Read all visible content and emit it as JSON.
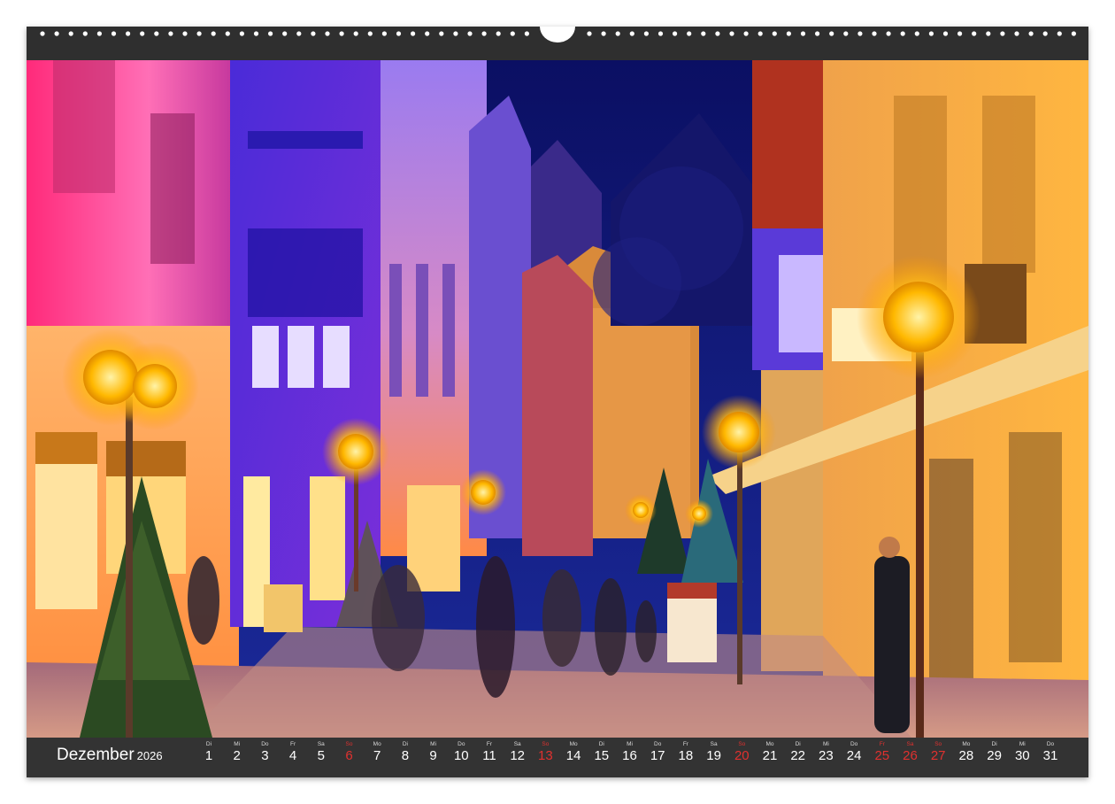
{
  "calendar": {
    "month": "Dezember",
    "year": "2026",
    "days": [
      {
        "wd": "Di",
        "num": "1",
        "red": false
      },
      {
        "wd": "Mi",
        "num": "2",
        "red": false
      },
      {
        "wd": "Do",
        "num": "3",
        "red": false
      },
      {
        "wd": "Fr",
        "num": "4",
        "red": false
      },
      {
        "wd": "Sa",
        "num": "5",
        "red": false
      },
      {
        "wd": "So",
        "num": "6",
        "red": true
      },
      {
        "wd": "Mo",
        "num": "7",
        "red": false
      },
      {
        "wd": "Di",
        "num": "8",
        "red": false
      },
      {
        "wd": "Mi",
        "num": "9",
        "red": false
      },
      {
        "wd": "Do",
        "num": "10",
        "red": false
      },
      {
        "wd": "Fr",
        "num": "11",
        "red": false
      },
      {
        "wd": "Sa",
        "num": "12",
        "red": false
      },
      {
        "wd": "So",
        "num": "13",
        "red": true
      },
      {
        "wd": "Mo",
        "num": "14",
        "red": false
      },
      {
        "wd": "Di",
        "num": "15",
        "red": false
      },
      {
        "wd": "Mi",
        "num": "16",
        "red": false
      },
      {
        "wd": "Do",
        "num": "17",
        "red": false
      },
      {
        "wd": "Fr",
        "num": "18",
        "red": false
      },
      {
        "wd": "Sa",
        "num": "19",
        "red": false
      },
      {
        "wd": "So",
        "num": "20",
        "red": true
      },
      {
        "wd": "Mo",
        "num": "21",
        "red": false
      },
      {
        "wd": "Di",
        "num": "22",
        "red": false
      },
      {
        "wd": "Mi",
        "num": "23",
        "red": false
      },
      {
        "wd": "Do",
        "num": "24",
        "red": false
      },
      {
        "wd": "Fr",
        "num": "25",
        "red": true
      },
      {
        "wd": "Sa",
        "num": "26",
        "red": true
      },
      {
        "wd": "So",
        "num": "27",
        "red": true
      },
      {
        "wd": "Mo",
        "num": "28",
        "red": false
      },
      {
        "wd": "Di",
        "num": "29",
        "red": false
      },
      {
        "wd": "Mi",
        "num": "30",
        "red": false
      },
      {
        "wd": "Do",
        "num": "31",
        "red": false
      }
    ]
  },
  "colors": {
    "frame": "#2f2f2f",
    "footer": "#333333",
    "holiday": "#e0312f",
    "lamp": "#ffc21a"
  }
}
